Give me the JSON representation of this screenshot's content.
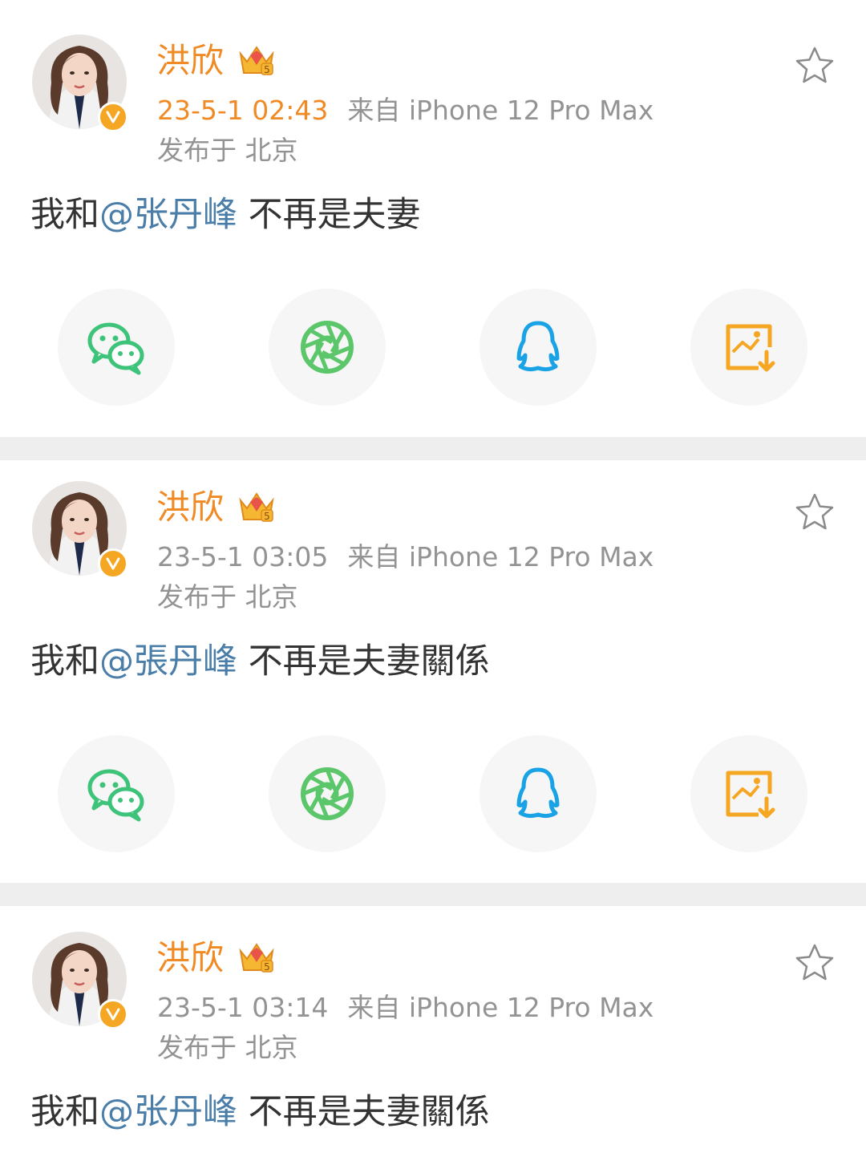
{
  "posts": [
    {
      "username": "洪欣",
      "time": "23-5-1 02:43",
      "source": "来自 iPhone 12 Pro Max",
      "location": "发布于 北京",
      "content_prefix": "我和",
      "mention": "@张丹峰",
      "content_suffix": " 不再是夫妻",
      "has_share_row": true
    },
    {
      "username": "洪欣",
      "time": "23-5-1 03:05",
      "source": "来自 iPhone 12 Pro Max",
      "location": "发布于 北京",
      "content_prefix": "我和",
      "mention": "@張丹峰",
      "content_suffix": " 不再是夫妻關係",
      "has_share_row": true
    },
    {
      "username": "洪欣",
      "time": "23-5-1 03:14",
      "source": "来自 iPhone 12 Pro Max",
      "location": "发布于 北京",
      "content_prefix": "我和",
      "mention": "@张丹峰",
      "content_suffix": " 不再是夫妻關係",
      "has_share_row": false
    }
  ],
  "share_buttons": [
    {
      "icon": "wechat-icon",
      "color": "#3ec37a"
    },
    {
      "icon": "moments-icon",
      "color": "#5cc66a"
    },
    {
      "icon": "qq-icon",
      "color": "#1aa2e6"
    },
    {
      "icon": "save-image-icon",
      "color": "#f5a623"
    }
  ],
  "colors": {
    "username": "#f08a24",
    "mention": "#4a7ea8",
    "meta": "#939393",
    "separator": "#eeeeee",
    "verified": "#f5a623"
  }
}
